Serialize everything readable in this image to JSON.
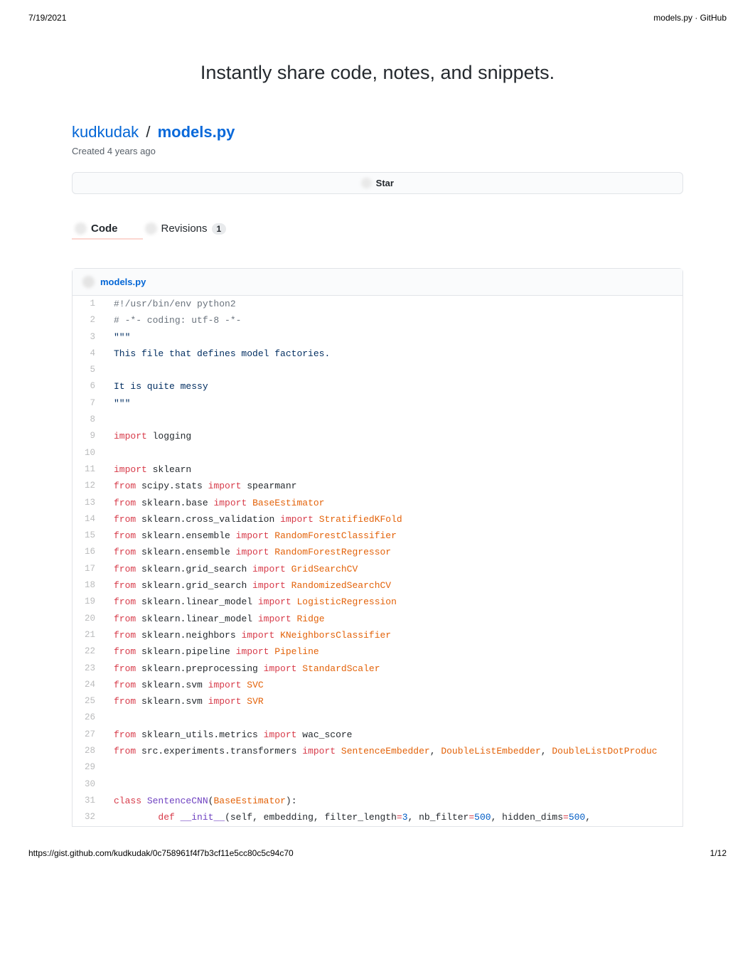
{
  "print_header": {
    "date": "7/19/2021",
    "title": "models.py · GitHub"
  },
  "tagline": "Instantly share code, notes, and snippets.",
  "gist": {
    "author": "kudkudak",
    "slash": "/",
    "file": "models.py",
    "created": "Created 4 years ago"
  },
  "star": {
    "label": "Star"
  },
  "tabs": {
    "code": {
      "label": "Code"
    },
    "revisions": {
      "label": "Revisions",
      "count": "1"
    }
  },
  "file_header": {
    "name": "models.py"
  },
  "footer": {
    "url": "https://gist.github.com/kudkudak/0c758961f4f7b3cf11e5cc80c5c94c70",
    "page": "1/12"
  },
  "code": {
    "lines": [
      {
        "n": "1",
        "t": "shebang",
        "v": "#!/usr/bin/env python2"
      },
      {
        "n": "2",
        "t": "comment",
        "v": "# -*- coding: utf-8 -*-"
      },
      {
        "n": "3",
        "t": "docq",
        "v": "\"\"\""
      },
      {
        "n": "4",
        "t": "doc",
        "v": "This file that defines model factories."
      },
      {
        "n": "5",
        "t": "blank",
        "v": ""
      },
      {
        "n": "6",
        "t": "doc",
        "v": "It is quite messy"
      },
      {
        "n": "7",
        "t": "docq",
        "v": "\"\"\""
      },
      {
        "n": "8",
        "t": "blank",
        "v": ""
      },
      {
        "n": "9",
        "t": "import1",
        "mod": "logging"
      },
      {
        "n": "10",
        "t": "blank",
        "v": ""
      },
      {
        "n": "11",
        "t": "import1",
        "mod": "sklearn"
      },
      {
        "n": "12",
        "t": "from",
        "pkg": "scipy.stats",
        "name": "spearmanr"
      },
      {
        "n": "13",
        "t": "from_en",
        "pkg": "sklearn.base",
        "name": "BaseEstimator"
      },
      {
        "n": "14",
        "t": "from_en",
        "pkg": "sklearn.cross_validation",
        "name": "StratifiedKFold"
      },
      {
        "n": "15",
        "t": "from_en",
        "pkg": "sklearn.ensemble",
        "name": "RandomForestClassifier"
      },
      {
        "n": "16",
        "t": "from_en",
        "pkg": "sklearn.ensemble",
        "name": "RandomForestRegressor"
      },
      {
        "n": "17",
        "t": "from_en",
        "pkg": "sklearn.grid_search",
        "name": "GridSearchCV"
      },
      {
        "n": "18",
        "t": "from_en",
        "pkg": "sklearn.grid_search",
        "name": "RandomizedSearchCV"
      },
      {
        "n": "19",
        "t": "from_en",
        "pkg": "sklearn.linear_model",
        "name": "LogisticRegression"
      },
      {
        "n": "20",
        "t": "from_en",
        "pkg": "sklearn.linear_model",
        "name": "Ridge"
      },
      {
        "n": "21",
        "t": "from_en",
        "pkg": "sklearn.neighbors",
        "name": "KNeighborsClassifier"
      },
      {
        "n": "22",
        "t": "from_en",
        "pkg": "sklearn.pipeline",
        "name": "Pipeline"
      },
      {
        "n": "23",
        "t": "from_en",
        "pkg": "sklearn.preprocessing",
        "name": "StandardScaler"
      },
      {
        "n": "24",
        "t": "from_en",
        "pkg": "sklearn.svm",
        "name": "SVC"
      },
      {
        "n": "25",
        "t": "from_en",
        "pkg": "sklearn.svm",
        "name": "SVR"
      },
      {
        "n": "26",
        "t": "blank",
        "v": ""
      },
      {
        "n": "27",
        "t": "from",
        "pkg": "sklearn_utils.metrics",
        "name": "wac_score"
      },
      {
        "n": "28",
        "t": "from3",
        "pkg": "src.experiments.transformers",
        "n1": "SentenceEmbedder",
        "n2": "DoubleListEmbedder",
        "n3": "DoubleListDotProduc"
      },
      {
        "n": "29",
        "t": "blank",
        "v": ""
      },
      {
        "n": "30",
        "t": "blank",
        "v": ""
      },
      {
        "n": "31",
        "t": "classdef",
        "cls": "SentenceCNN",
        "base": "BaseEstimator"
      },
      {
        "n": "32",
        "t": "init",
        "indent": "        ",
        "text": "(self, embedding, filter_length",
        "eq": "=",
        "c1": "3",
        "p2": ", nb_filter",
        "c2": "500",
        "p3": ", hidden_dims",
        "c3": "500",
        "tail": ","
      }
    ]
  }
}
